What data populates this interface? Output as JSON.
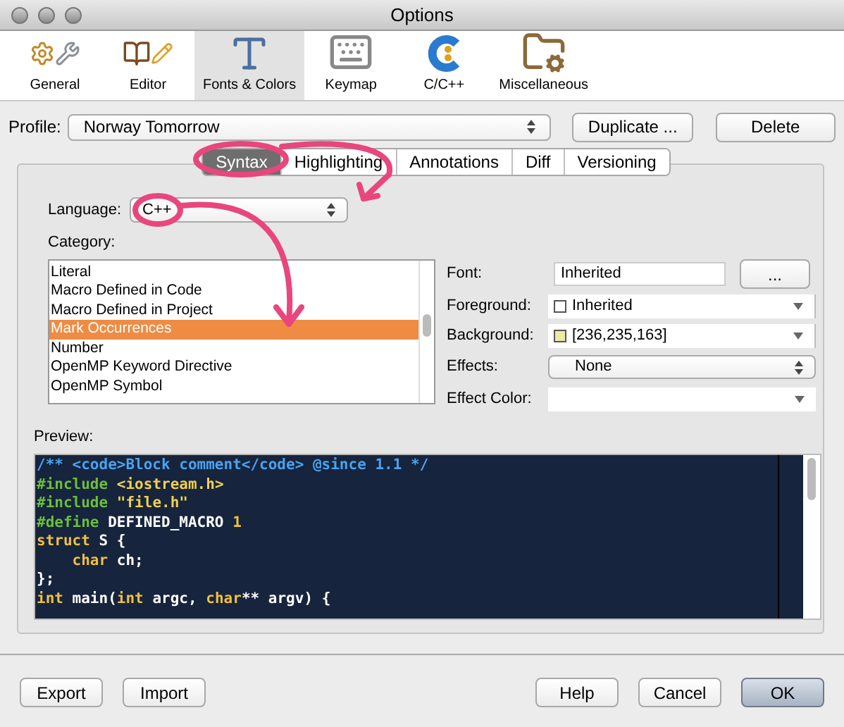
{
  "window": {
    "title": "Options"
  },
  "toolbar": [
    {
      "label": "General",
      "kind": "general",
      "selected": false
    },
    {
      "label": "Editor",
      "kind": "editor",
      "selected": false
    },
    {
      "label": "Fonts & Colors",
      "kind": "fonts",
      "selected": true
    },
    {
      "label": "Keymap",
      "kind": "keymap",
      "selected": false
    },
    {
      "label": "C/C++",
      "kind": "cpp",
      "selected": false
    },
    {
      "label": "Miscellaneous",
      "kind": "misc",
      "selected": false
    }
  ],
  "profile": {
    "label": "Profile:",
    "value": "Norway Tomorrow"
  },
  "profile_buttons": [
    "Duplicate ...",
    "Delete"
  ],
  "tabs": [
    {
      "label": "Syntax",
      "selected": true
    },
    {
      "label": "Highlighting",
      "selected": false
    },
    {
      "label": "Annotations",
      "selected": false
    },
    {
      "label": "Diff",
      "selected": false
    },
    {
      "label": "Versioning",
      "selected": false
    }
  ],
  "language": {
    "label": "Language:",
    "value": "C++"
  },
  "category": {
    "label": "Category:",
    "items": [
      {
        "label": "Literal",
        "selected": false
      },
      {
        "label": "Macro Defined in Code",
        "selected": false
      },
      {
        "label": "Macro Defined in Project",
        "selected": false
      },
      {
        "label": "Mark Occurrences",
        "selected": true
      },
      {
        "label": "Number",
        "selected": false
      },
      {
        "label": "OpenMP Keyword Directive",
        "selected": false
      },
      {
        "label": "OpenMP Symbol",
        "selected": false
      }
    ]
  },
  "font": {
    "label": "Font:",
    "value": "Inherited",
    "button": "..."
  },
  "foreground": {
    "label": "Foreground:",
    "value": "Inherited",
    "color": "#ffffff"
  },
  "background": {
    "label": "Background:",
    "value": "[236,235,163]",
    "color": "#eceba3"
  },
  "effects": {
    "label": "Effects:",
    "value": "None"
  },
  "effect_color": {
    "label": "Effect Color:"
  },
  "preview": {
    "label": "Preview:",
    "lines": [
      [
        {
          "text": "/** <code>Block comment</code> @since 1.1 */",
          "kind": "comment"
        }
      ],
      [
        {
          "text": "#include ",
          "kind": "preprocessor"
        },
        {
          "text": "<iostream.h>",
          "kind": "string"
        }
      ],
      [
        {
          "text": "#include ",
          "kind": "preprocessor"
        },
        {
          "text": "\"file.h\"",
          "kind": "string"
        }
      ],
      [
        {
          "text": "#define ",
          "kind": "preprocessor"
        },
        {
          "text": "DEFINED_MACRO ",
          "kind": "plain"
        },
        {
          "text": "1",
          "kind": "number"
        }
      ],
      [
        {
          "text": "struct",
          "kind": "keyword"
        },
        {
          "text": " S {",
          "kind": "plain"
        }
      ],
      [
        {
          "text": "    char",
          "kind": "keyword"
        },
        {
          "text": " ch;",
          "kind": "plain"
        }
      ],
      [
        {
          "text": "};",
          "kind": "plain"
        }
      ],
      [
        {
          "text": "int",
          "kind": "keyword"
        },
        {
          "text": " main(",
          "kind": "plain"
        },
        {
          "text": "int",
          "kind": "keyword"
        },
        {
          "text": " argc, ",
          "kind": "plain"
        },
        {
          "text": "char",
          "kind": "keyword"
        },
        {
          "text": "** argv) {",
          "kind": "plain"
        }
      ]
    ]
  },
  "footer_left": [
    "Export",
    "Import"
  ],
  "footer_right": [
    {
      "label": "Help",
      "default": false
    },
    {
      "label": "Cancel",
      "default": false
    },
    {
      "label": "OK",
      "default": true
    }
  ]
}
